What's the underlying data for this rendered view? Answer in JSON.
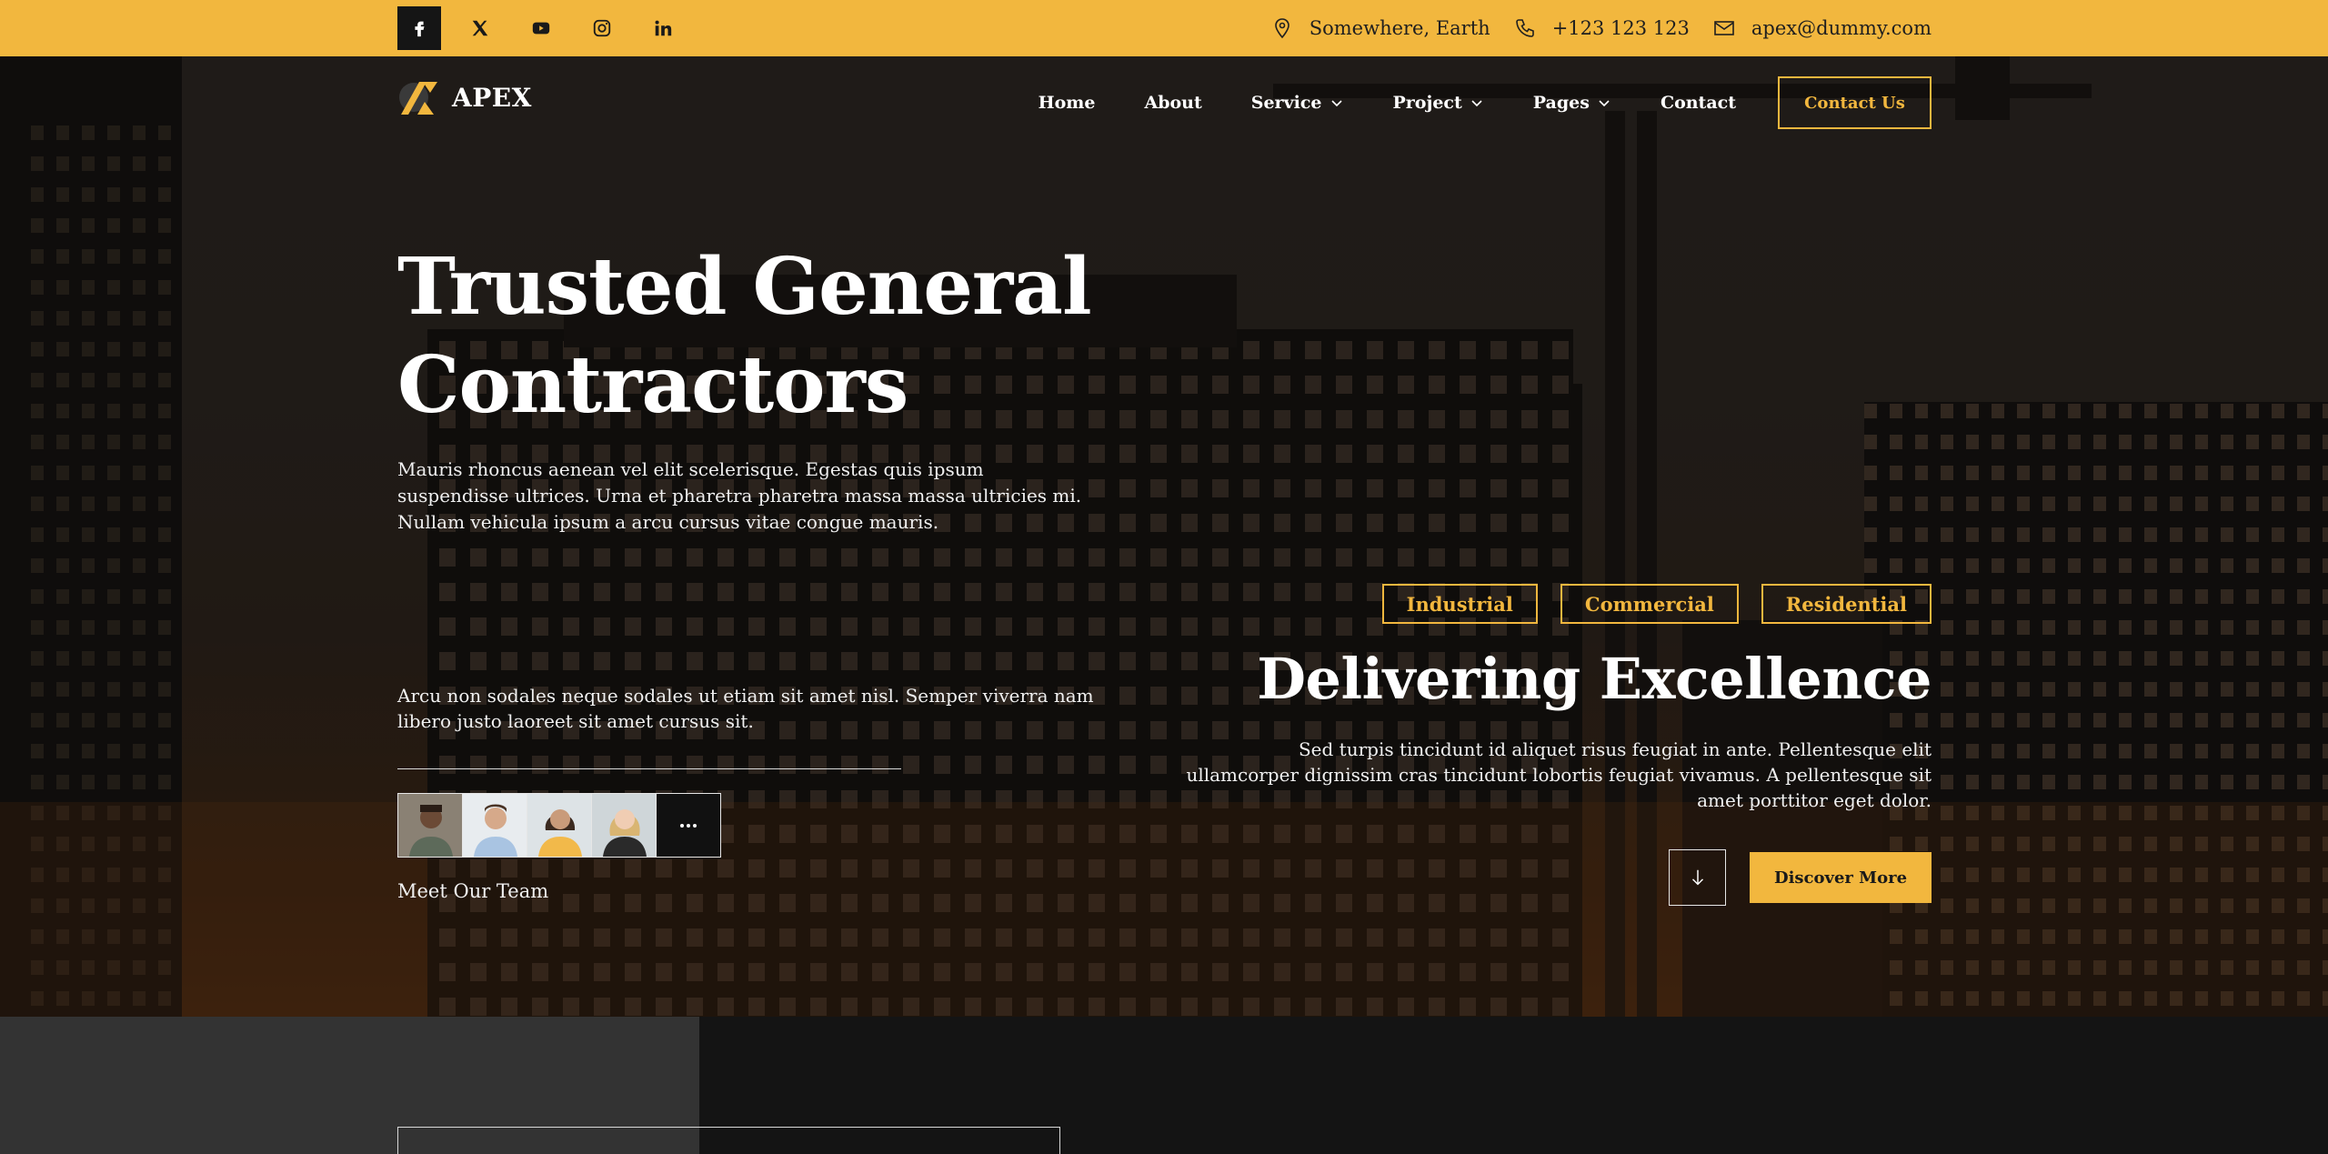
{
  "topbar": {
    "social": [
      "facebook-icon",
      "x-twitter-icon",
      "youtube-icon",
      "instagram-icon",
      "linkedin-icon"
    ],
    "location": "Somewhere, Earth",
    "phone": "+123 123 123",
    "email": "apex@dummy.com"
  },
  "brand": {
    "name": "APEX"
  },
  "nav": {
    "items": [
      {
        "label": "Home"
      },
      {
        "label": "About"
      },
      {
        "label": "Service"
      },
      {
        "label": "Project"
      },
      {
        "label": "Pages"
      },
      {
        "label": "Contact"
      }
    ],
    "cta": "Contact Us"
  },
  "hero": {
    "title_line1": "Trusted General",
    "title_line2": "Contractors",
    "lead": "Mauris rhoncus aenean vel elit scelerisque. Egestas quis ipsum suspendisse ultrices. Urna et pharetra pharetra massa massa ultricies mi. Nullam vehicula ipsum a arcu cursus vitae congue mauris.",
    "sub": "Arcu non sodales neque sodales ut etiam sit amet nisl. Semper viverra nam libero justo laoreet sit amet cursus sit.",
    "team_label": "Meet Our Team",
    "tags": [
      "Industrial",
      "Commercial",
      "Residential"
    ],
    "excellence_title": "Delivering Excellence",
    "excellence_text": "Sed turpis tincidunt id aliquet risus feugiat in ante. Pellentesque elit ullamcorper dignissim cras tincidunt lobortis feugiat vivamus. A pellentesque sit amet porttitor eget dolor.",
    "discover": "Discover More"
  },
  "colors": {
    "accent": "#F2B73E",
    "dark": "#141414",
    "panel": "#333333"
  }
}
